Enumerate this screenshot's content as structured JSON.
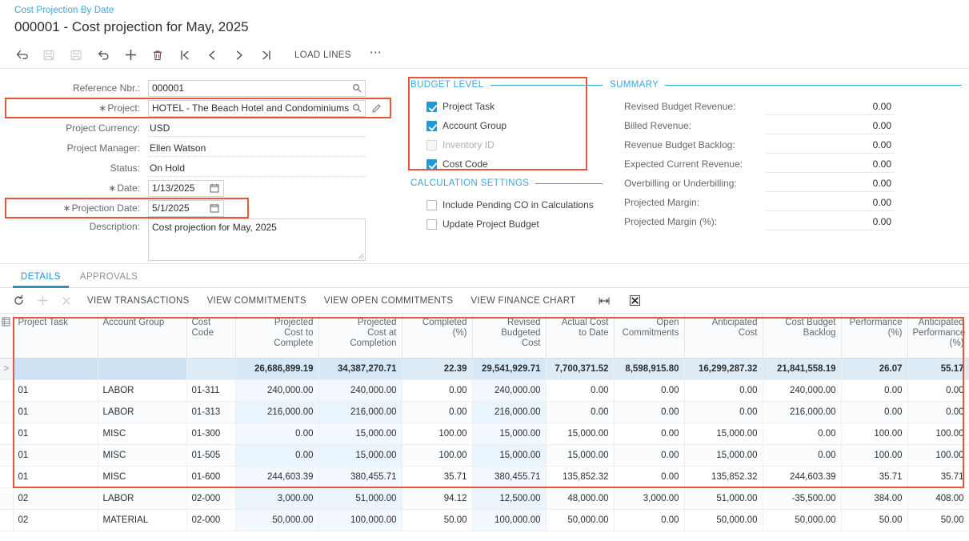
{
  "header": {
    "breadcrumb": "Cost Projection By Date",
    "title": "000001 - Cost projection for May, 2025"
  },
  "toolbar": {
    "icons": [
      {
        "name": "back-arrow-icon",
        "label": "Back"
      },
      {
        "name": "save-and-close-icon",
        "label": "Save & Close"
      },
      {
        "name": "save-icon",
        "label": "Save"
      },
      {
        "name": "undo-icon",
        "label": "Cancel"
      },
      {
        "name": "add-icon",
        "label": "Add New Record"
      },
      {
        "name": "delete-icon",
        "label": "Delete"
      },
      {
        "name": "first-record-icon",
        "label": "First"
      },
      {
        "name": "previous-record-icon",
        "label": "Previous"
      },
      {
        "name": "next-record-icon",
        "label": "Next"
      },
      {
        "name": "last-record-icon",
        "label": "Last"
      }
    ],
    "load_lines_label": "LOAD LINES",
    "more_label": "⋯"
  },
  "form": {
    "reference_nbr": {
      "label": "Reference Nbr.:",
      "value": "000001"
    },
    "project": {
      "label": "Project:",
      "value": "HOTEL - The Beach Hotel and Condominiums",
      "required": "∗"
    },
    "project_currency": {
      "label": "Project Currency:",
      "value": "USD"
    },
    "project_manager": {
      "label": "Project Manager:",
      "value": "Ellen Watson"
    },
    "status": {
      "label": "Status:",
      "value": "On Hold"
    },
    "date": {
      "label": "Date:",
      "value": "1/13/2025",
      "required": "∗"
    },
    "projection_date": {
      "label": "Projection Date:",
      "value": "5/1/2025",
      "required": "∗"
    },
    "description": {
      "label": "Description:",
      "value": "Cost projection for May, 2025"
    }
  },
  "budget_level": {
    "title": "BUDGET LEVEL",
    "items": [
      {
        "label": "Project Task",
        "checked": true,
        "disabled": false
      },
      {
        "label": "Account Group",
        "checked": true,
        "disabled": false
      },
      {
        "label": "Inventory ID",
        "checked": false,
        "disabled": true
      },
      {
        "label": "Cost Code",
        "checked": true,
        "disabled": false
      }
    ]
  },
  "calculation_settings": {
    "title": "CALCULATION SETTINGS",
    "items": [
      {
        "label": "Include Pending CO in Calculations",
        "checked": false,
        "disabled": false
      },
      {
        "label": "Update Project Budget",
        "checked": false,
        "disabled": false
      }
    ]
  },
  "summary": {
    "title": "SUMMARY",
    "rows": [
      {
        "label": "Revised Budget Revenue:",
        "value": "0.00"
      },
      {
        "label": "Billed Revenue:",
        "value": "0.00"
      },
      {
        "label": "Revenue Budget Backlog:",
        "value": "0.00"
      },
      {
        "label": "Expected Current Revenue:",
        "value": "0.00"
      },
      {
        "label": "Overbilling or Underbilling:",
        "value": "0.00"
      },
      {
        "label": "Projected Margin:",
        "value": "0.00"
      },
      {
        "label": "Projected Margin (%):",
        "value": "0.00"
      }
    ]
  },
  "tabs": [
    {
      "label": "DETAILS",
      "active": true
    },
    {
      "label": "APPROVALS",
      "active": false
    }
  ],
  "grid_toolbar": {
    "icons": [
      {
        "name": "refresh-icon",
        "disabled": false
      },
      {
        "name": "add-row-icon",
        "disabled": true
      },
      {
        "name": "delete-row-icon",
        "disabled": true
      }
    ],
    "buttons": [
      "VIEW TRANSACTIONS",
      "VIEW COMMITMENTS",
      "VIEW OPEN COMMITMENTS",
      "VIEW FINANCE CHART"
    ],
    "right_icons": [
      {
        "name": "fit-columns-icon"
      },
      {
        "name": "export-to-excel-icon"
      }
    ]
  },
  "grid": {
    "columns": [
      {
        "header": "Project Task",
        "align": "txt"
      },
      {
        "header": "Account Group",
        "align": "txt"
      },
      {
        "header": "Cost\nCode",
        "align": "txt"
      },
      {
        "header": "Projected\nCost to\nComplete",
        "align": "num"
      },
      {
        "header": "Projected\nCost at\nCompletion",
        "align": "num"
      },
      {
        "header": "Completed\n(%)",
        "align": "num"
      },
      {
        "header": "Revised\nBudgeted\nCost",
        "align": "num"
      },
      {
        "header": "Actual Cost\nto Date",
        "align": "num"
      },
      {
        "header": "Open\nCommitments",
        "align": "num"
      },
      {
        "header": "Anticipated\nCost",
        "align": "num"
      },
      {
        "header": "Cost Budget\nBacklog",
        "align": "num"
      },
      {
        "header": "Performance\n(%)",
        "align": "num"
      },
      {
        "header": "Anticipated\nPerformance\n(%)",
        "align": "num"
      }
    ],
    "total_row": [
      "",
      "",
      "",
      "26,686,899.19",
      "34,387,270.71",
      "22.39",
      "29,541,929.71",
      "7,700,371.52",
      "8,598,915.80",
      "16,299,287.32",
      "21,841,558.19",
      "26.07",
      "55.17"
    ],
    "rows": [
      [
        "01",
        "LABOR",
        "01-311",
        "240,000.00",
        "240,000.00",
        "0.00",
        "240,000.00",
        "0.00",
        "0.00",
        "0.00",
        "240,000.00",
        "0.00",
        "0.00"
      ],
      [
        "01",
        "LABOR",
        "01-313",
        "216,000.00",
        "216,000.00",
        "0.00",
        "216,000.00",
        "0.00",
        "0.00",
        "0.00",
        "216,000.00",
        "0.00",
        "0.00"
      ],
      [
        "01",
        "MISC",
        "01-300",
        "0.00",
        "15,000.00",
        "100.00",
        "15,000.00",
        "15,000.00",
        "0.00",
        "15,000.00",
        "0.00",
        "100.00",
        "100.00"
      ],
      [
        "01",
        "MISC",
        "01-505",
        "0.00",
        "15,000.00",
        "100.00",
        "15,000.00",
        "15,000.00",
        "0.00",
        "15,000.00",
        "0.00",
        "100.00",
        "100.00"
      ],
      [
        "01",
        "MISC",
        "01-600",
        "244,603.39",
        "380,455.71",
        "35.71",
        "380,455.71",
        "135,852.32",
        "0.00",
        "135,852.32",
        "244,603.39",
        "35.71",
        "35.71"
      ],
      [
        "02",
        "LABOR",
        "02-000",
        "3,000.00",
        "51,000.00",
        "94.12",
        "12,500.00",
        "48,000.00",
        "3,000.00",
        "51,000.00",
        "-35,500.00",
        "384.00",
        "408.00"
      ],
      [
        "02",
        "MATERIAL",
        "02-000",
        "50,000.00",
        "100,000.00",
        "50.00",
        "100,000.00",
        "50,000.00",
        "0.00",
        "50,000.00",
        "50,000.00",
        "50.00",
        "50.00"
      ]
    ]
  },
  "colors": {
    "accent_blue": "#3ca4dd",
    "highlight_red": "#e8553a",
    "total_row_bg": "#ddebf7",
    "checkbox_checked": "#1a9ae0"
  }
}
